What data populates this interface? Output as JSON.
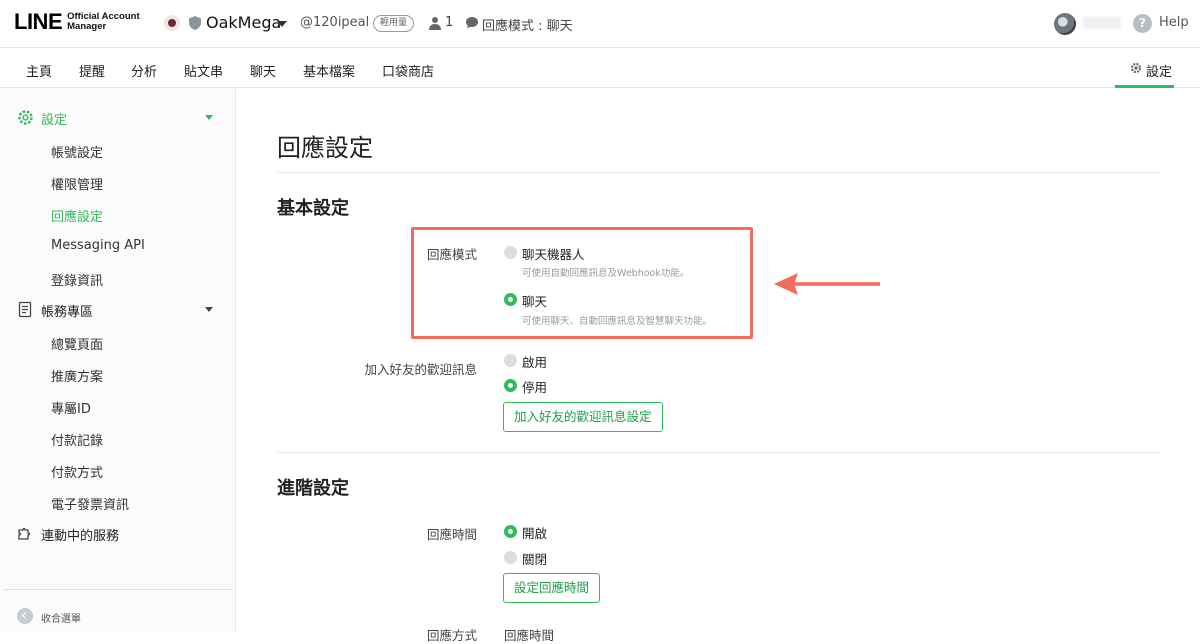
{
  "header": {
    "logo_main": "LINE",
    "logo_sub_line1": "Official Account",
    "logo_sub_line2": "Manager",
    "account_name": "OakMega",
    "account_id": "@120ipeal",
    "plan_badge": "輕用量",
    "friends_count": "1",
    "reply_mode": "回應模式 : 聊天",
    "help": "Help"
  },
  "nav": {
    "tabs": [
      "主頁",
      "提醒",
      "分析",
      "貼文串",
      "聊天",
      "基本檔案",
      "口袋商店"
    ],
    "settings": "設定"
  },
  "sidebar": {
    "settings_group": "設定",
    "settings_items": [
      "帳號設定",
      "權限管理",
      "回應設定",
      "Messaging API",
      "登錄資訊"
    ],
    "billing_group": "帳務專區",
    "billing_items": [
      "總覽頁面",
      "推廣方案",
      "專屬ID",
      "付款記錄",
      "付款方式",
      "電子發票資訊"
    ],
    "services": "連動中的服務",
    "collapse": "收合選單"
  },
  "main": {
    "title": "回應設定",
    "basic": {
      "title": "基本設定",
      "reply_mode_label": "回應模式",
      "bot_option": "聊天機器人",
      "bot_desc": "可使用自動回應訊息及Webhook功能。",
      "chat_option": "聊天",
      "chat_desc": "可使用聊天、自動回應訊息及智慧聊天功能。",
      "selected_mode": "聊天",
      "greeting_label": "加入好友的歡迎訊息",
      "greeting_on": "啟用",
      "greeting_off": "停用",
      "greeting_selected": "停用",
      "greeting_button": "加入好友的歡迎訊息設定"
    },
    "advanced": {
      "title": "進階設定",
      "hours_label": "回應時間",
      "hours_on": "開啟",
      "hours_off": "關閉",
      "hours_selected": "開啟",
      "hours_button": "設定回應時間",
      "method_label": "回應方式",
      "method_value": "回應時間"
    }
  },
  "colors": {
    "accent_green": "#2ebd5a",
    "highlight_red": "#f26b5b"
  }
}
